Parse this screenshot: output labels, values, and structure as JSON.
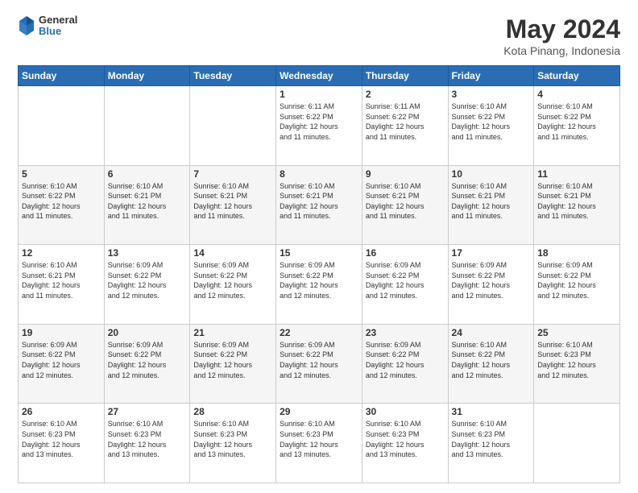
{
  "header": {
    "logo": {
      "general": "General",
      "blue": "Blue"
    },
    "title": "May 2024",
    "subtitle": "Kota Pinang, Indonesia"
  },
  "calendar": {
    "days_of_week": [
      "Sunday",
      "Monday",
      "Tuesday",
      "Wednesday",
      "Thursday",
      "Friday",
      "Saturday"
    ],
    "weeks": [
      [
        {
          "day": "",
          "info": ""
        },
        {
          "day": "",
          "info": ""
        },
        {
          "day": "",
          "info": ""
        },
        {
          "day": "1",
          "info": "Sunrise: 6:11 AM\nSunset: 6:22 PM\nDaylight: 12 hours\nand 11 minutes."
        },
        {
          "day": "2",
          "info": "Sunrise: 6:11 AM\nSunset: 6:22 PM\nDaylight: 12 hours\nand 11 minutes."
        },
        {
          "day": "3",
          "info": "Sunrise: 6:10 AM\nSunset: 6:22 PM\nDaylight: 12 hours\nand 11 minutes."
        },
        {
          "day": "4",
          "info": "Sunrise: 6:10 AM\nSunset: 6:22 PM\nDaylight: 12 hours\nand 11 minutes."
        }
      ],
      [
        {
          "day": "5",
          "info": "Sunrise: 6:10 AM\nSunset: 6:22 PM\nDaylight: 12 hours\nand 11 minutes."
        },
        {
          "day": "6",
          "info": "Sunrise: 6:10 AM\nSunset: 6:21 PM\nDaylight: 12 hours\nand 11 minutes."
        },
        {
          "day": "7",
          "info": "Sunrise: 6:10 AM\nSunset: 6:21 PM\nDaylight: 12 hours\nand 11 minutes."
        },
        {
          "day": "8",
          "info": "Sunrise: 6:10 AM\nSunset: 6:21 PM\nDaylight: 12 hours\nand 11 minutes."
        },
        {
          "day": "9",
          "info": "Sunrise: 6:10 AM\nSunset: 6:21 PM\nDaylight: 12 hours\nand 11 minutes."
        },
        {
          "day": "10",
          "info": "Sunrise: 6:10 AM\nSunset: 6:21 PM\nDaylight: 12 hours\nand 11 minutes."
        },
        {
          "day": "11",
          "info": "Sunrise: 6:10 AM\nSunset: 6:21 PM\nDaylight: 12 hours\nand 11 minutes."
        }
      ],
      [
        {
          "day": "12",
          "info": "Sunrise: 6:10 AM\nSunset: 6:21 PM\nDaylight: 12 hours\nand 11 minutes."
        },
        {
          "day": "13",
          "info": "Sunrise: 6:09 AM\nSunset: 6:22 PM\nDaylight: 12 hours\nand 12 minutes."
        },
        {
          "day": "14",
          "info": "Sunrise: 6:09 AM\nSunset: 6:22 PM\nDaylight: 12 hours\nand 12 minutes."
        },
        {
          "day": "15",
          "info": "Sunrise: 6:09 AM\nSunset: 6:22 PM\nDaylight: 12 hours\nand 12 minutes."
        },
        {
          "day": "16",
          "info": "Sunrise: 6:09 AM\nSunset: 6:22 PM\nDaylight: 12 hours\nand 12 minutes."
        },
        {
          "day": "17",
          "info": "Sunrise: 6:09 AM\nSunset: 6:22 PM\nDaylight: 12 hours\nand 12 minutes."
        },
        {
          "day": "18",
          "info": "Sunrise: 6:09 AM\nSunset: 6:22 PM\nDaylight: 12 hours\nand 12 minutes."
        }
      ],
      [
        {
          "day": "19",
          "info": "Sunrise: 6:09 AM\nSunset: 6:22 PM\nDaylight: 12 hours\nand 12 minutes."
        },
        {
          "day": "20",
          "info": "Sunrise: 6:09 AM\nSunset: 6:22 PM\nDaylight: 12 hours\nand 12 minutes."
        },
        {
          "day": "21",
          "info": "Sunrise: 6:09 AM\nSunset: 6:22 PM\nDaylight: 12 hours\nand 12 minutes."
        },
        {
          "day": "22",
          "info": "Sunrise: 6:09 AM\nSunset: 6:22 PM\nDaylight: 12 hours\nand 12 minutes."
        },
        {
          "day": "23",
          "info": "Sunrise: 6:09 AM\nSunset: 6:22 PM\nDaylight: 12 hours\nand 12 minutes."
        },
        {
          "day": "24",
          "info": "Sunrise: 6:10 AM\nSunset: 6:22 PM\nDaylight: 12 hours\nand 12 minutes."
        },
        {
          "day": "25",
          "info": "Sunrise: 6:10 AM\nSunset: 6:23 PM\nDaylight: 12 hours\nand 12 minutes."
        }
      ],
      [
        {
          "day": "26",
          "info": "Sunrise: 6:10 AM\nSunset: 6:23 PM\nDaylight: 12 hours\nand 13 minutes."
        },
        {
          "day": "27",
          "info": "Sunrise: 6:10 AM\nSunset: 6:23 PM\nDaylight: 12 hours\nand 13 minutes."
        },
        {
          "day": "28",
          "info": "Sunrise: 6:10 AM\nSunset: 6:23 PM\nDaylight: 12 hours\nand 13 minutes."
        },
        {
          "day": "29",
          "info": "Sunrise: 6:10 AM\nSunset: 6:23 PM\nDaylight: 12 hours\nand 13 minutes."
        },
        {
          "day": "30",
          "info": "Sunrise: 6:10 AM\nSunset: 6:23 PM\nDaylight: 12 hours\nand 13 minutes."
        },
        {
          "day": "31",
          "info": "Sunrise: 6:10 AM\nSunset: 6:23 PM\nDaylight: 12 hours\nand 13 minutes."
        },
        {
          "day": "",
          "info": ""
        }
      ]
    ]
  }
}
